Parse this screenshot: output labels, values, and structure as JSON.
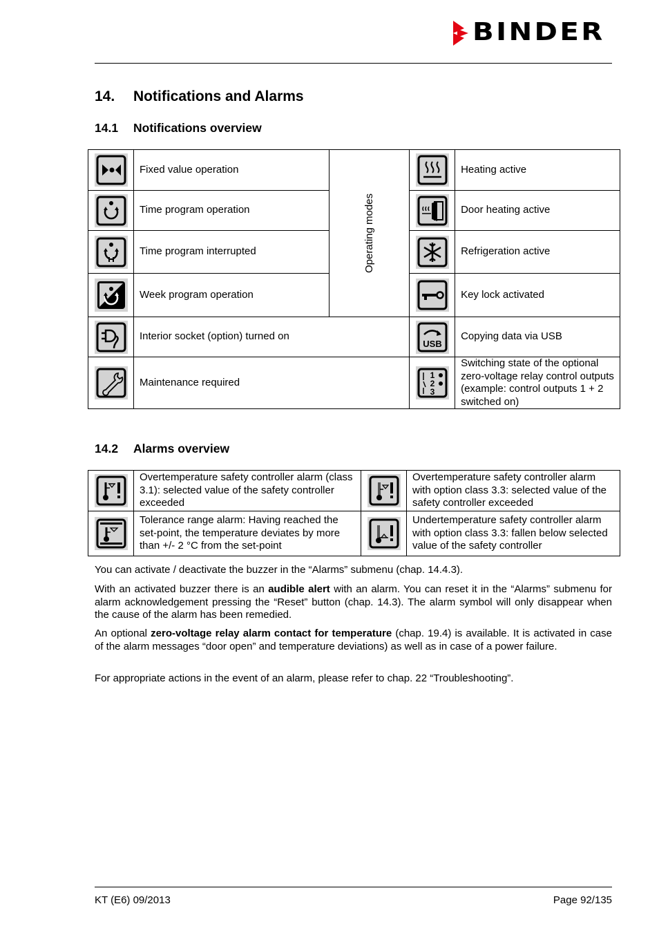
{
  "header": {
    "brand": "BINDER",
    "brand_color": "#e30613"
  },
  "chapter": {
    "number": "14.",
    "title": "Notifications and Alarms"
  },
  "notifications": {
    "number": "14.1",
    "title": "Notifications overview",
    "operating_modes_label": "Operating modes",
    "left": [
      {
        "icon": "fixed-value-icon",
        "label": "Fixed value operation"
      },
      {
        "icon": "time-program-icon",
        "label": "Time program operation"
      },
      {
        "icon": "time-program-interrupted-icon",
        "label": "Time program interrupted"
      },
      {
        "icon": "week-program-icon",
        "label": "Week program operation"
      },
      {
        "icon": "interior-socket-icon",
        "label": "Interior socket (option) turned on"
      },
      {
        "icon": "wrench-icon",
        "label": "Maintenance required"
      }
    ],
    "right": [
      {
        "icon": "heating-icon",
        "label": "Heating active"
      },
      {
        "icon": "door-heating-icon",
        "label": "Door heating active"
      },
      {
        "icon": "snowflake-icon",
        "label": "Refrigeration active"
      },
      {
        "icon": "key-icon",
        "label": "Key lock activated"
      },
      {
        "icon": "usb-icon",
        "label": "Copying data via USB",
        "glyph_text": "USB"
      },
      {
        "icon": "relay-outputs-icon",
        "label": "Switching state of the optional zero-voltage relay control outputs (example: control outputs 1 + 2 switched on)",
        "glyph_numbers": [
          "1",
          "2",
          "3"
        ]
      }
    ]
  },
  "alarms": {
    "number": "14.2",
    "title": "Alarms overview",
    "rows": [
      [
        {
          "icon": "overtemp-alarm-icon",
          "label": "Overtemperature safety controller alarm (class 3.1): selected value of the safety controller exceeded"
        },
        {
          "icon": "overtemp-class33-alarm-icon",
          "label": "Overtemperature safety controller alarm with option class 3.3: selected value of the safety controller exceeded"
        }
      ],
      [
        {
          "icon": "tolerance-range-alarm-icon",
          "label": "Tolerance range alarm: Having reached the set-point, the temperature deviates by more than +/- 2 °C from the set-point"
        },
        {
          "icon": "undertemp-alarm-icon",
          "label": "Undertemperature safety controller alarm with option class 3.3: fallen below selected value of the safety controller"
        }
      ]
    ]
  },
  "paragraphs": {
    "p1": "You can activate / deactivate the buzzer in the “Alarms” submenu (chap. 14.4.3).",
    "p2_a": "With an activated buzzer there is an ",
    "p2_bold": "audible alert",
    "p2_b": " with an alarm. You can reset it in the “Alarms” submenu for alarm acknowledgement pressing the “Reset” button (chap. 14.3). The alarm symbol will only disappear when the cause of the alarm has been remedied.",
    "p3_a": "An optional ",
    "p3_bold": "zero-voltage relay alarm contact for temperature",
    "p3_b": " (chap. 19.4) is available. It is activated in case of the alarm messages “door open” and temperature deviations) as well as in case of a power failure.",
    "p4": "For appropriate actions in the event of an alarm, please refer to chap. 22 “Troubleshooting”."
  },
  "footer": {
    "left": "KT (E6) 09/2013",
    "right": "Page 92/135"
  }
}
